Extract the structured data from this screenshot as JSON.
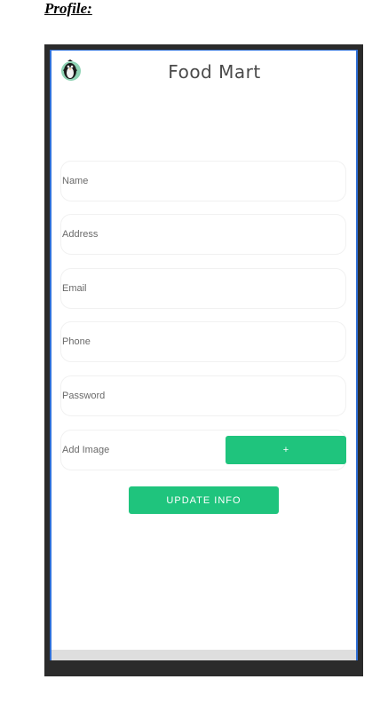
{
  "document": {
    "heading": "Profile:"
  },
  "app": {
    "title": "Food Mart",
    "logo_icon": "penguin-logo-icon",
    "accent_color": "#1fc47d"
  },
  "form": {
    "name_placeholder": "Name",
    "address_placeholder": "Address",
    "email_placeholder": "Email",
    "phone_placeholder": "Phone",
    "password_placeholder": "Password",
    "add_image_label": "Add Image",
    "add_image_button": "+",
    "update_button": "UPDATE INFO"
  }
}
